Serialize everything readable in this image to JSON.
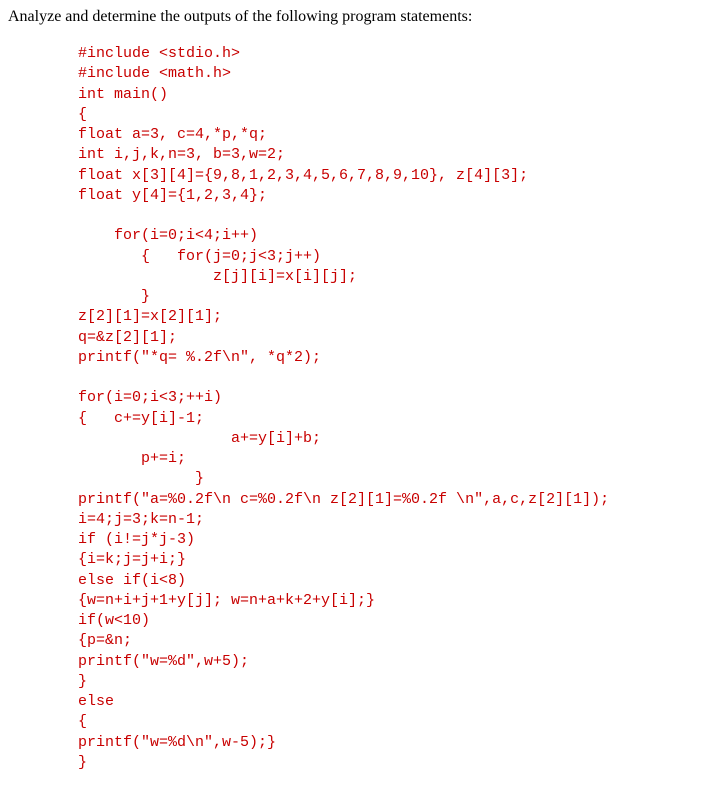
{
  "prompt": "Analyze and determine the outputs of the following program statements:",
  "code": "#include <stdio.h>\n#include <math.h>\nint main()\n{\nfloat a=3, c=4,*p,*q;\nint i,j,k,n=3, b=3,w=2;\nfloat x[3][4]={9,8,1,2,3,4,5,6,7,8,9,10}, z[4][3];\nfloat y[4]={1,2,3,4};\n\n    for(i=0;i<4;i++)\n       {   for(j=0;j<3;j++)\n               z[j][i]=x[i][j];\n       }\nz[2][1]=x[2][1];\nq=&z[2][1];\nprintf(\"*q= %.2f\\n\", *q*2);\n\nfor(i=0;i<3;++i)\n{   c+=y[i]-1;\n                 a+=y[i]+b;\n       p+=i;\n             }\nprintf(\"a=%0.2f\\n c=%0.2f\\n z[2][1]=%0.2f \\n\",a,c,z[2][1]);\ni=4;j=3;k=n-1;\nif (i!=j*j-3)\n{i=k;j=j+i;}\nelse if(i<8)\n{w=n+i+j+1+y[j]; w=n+a+k+2+y[i];}\nif(w<10)\n{p=&n;\nprintf(\"w=%d\",w+5);\n}\nelse\n{\nprintf(\"w=%d\\n\",w-5);}\n}"
}
